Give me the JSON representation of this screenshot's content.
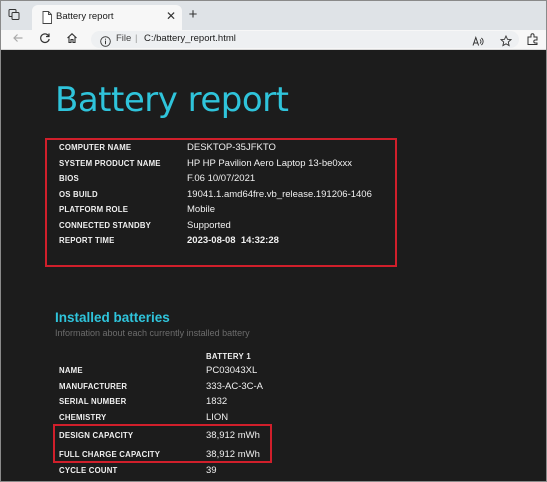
{
  "browser": {
    "tab_title": "Battery report",
    "address_scheme": "File",
    "address_url": "C:/battery_report.html"
  },
  "report": {
    "title": "Battery report",
    "system_info": [
      {
        "label": "COMPUTER NAME",
        "value": "DESKTOP-35JFKTO"
      },
      {
        "label": "SYSTEM PRODUCT NAME",
        "value": "HP HP Pavilion Aero Laptop 13-be0xxx"
      },
      {
        "label": "BIOS",
        "value": "F.06 10/07/2021"
      },
      {
        "label": "OS BUILD",
        "value": "19041.1.amd64fre.vb_release.191206-1406"
      },
      {
        "label": "PLATFORM ROLE",
        "value": "Mobile"
      },
      {
        "label": "CONNECTED STANDBY",
        "value": "Supported"
      },
      {
        "label": "REPORT TIME",
        "value": "2023-08-08  14:32:28"
      }
    ],
    "installed_batteries": {
      "title": "Installed batteries",
      "subtitle": "Information about each currently installed battery",
      "column_header": "BATTERY 1",
      "rows": [
        {
          "label": "NAME",
          "value": "PC03043XL"
        },
        {
          "label": "MANUFACTURER",
          "value": "333-AC-3C-A"
        },
        {
          "label": "SERIAL NUMBER",
          "value": "1832"
        },
        {
          "label": "CHEMISTRY",
          "value": "LION"
        },
        {
          "label": "DESIGN CAPACITY",
          "value": "38,912 mWh"
        },
        {
          "label": "FULL CHARGE CAPACITY",
          "value": "38,912 mWh"
        },
        {
          "label": "CYCLE COUNT",
          "value": "39"
        }
      ]
    }
  },
  "colors": {
    "accent": "#2fc4db",
    "highlight": "#d01f2b",
    "page_background": "#1c1c1c"
  }
}
